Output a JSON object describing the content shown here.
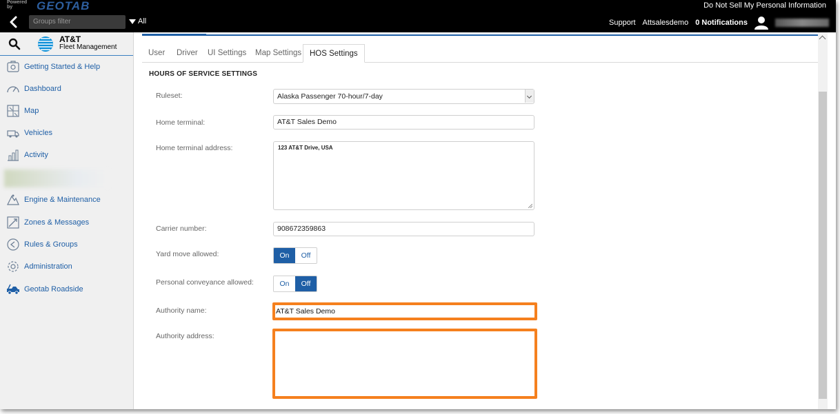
{
  "topbar": {
    "powered_by": "Powered by",
    "geotab": "GEOTAB",
    "do_not_sell": "Do Not Sell My Personal Information",
    "groups_filter_placeholder": "Groups filter",
    "all_label": "All",
    "support": "Support",
    "account": "Attsalesdemo",
    "notifications": "0 Notifications"
  },
  "sidebar": {
    "brand_line1": "AT&T",
    "brand_line2": "Fleet Management",
    "items": [
      {
        "label": "Getting Started & Help",
        "icon": "help-box-icon"
      },
      {
        "label": "Dashboard",
        "icon": "gauge-icon"
      },
      {
        "label": "Map",
        "icon": "map-icon"
      },
      {
        "label": "Vehicles",
        "icon": "truck-icon"
      },
      {
        "label": "Activity",
        "icon": "bar-chart-icon"
      },
      {
        "label": "Engine & Maintenance",
        "icon": "engine-icon"
      },
      {
        "label": "Zones & Messages",
        "icon": "zones-icon"
      },
      {
        "label": "Rules & Groups",
        "icon": "rules-icon"
      },
      {
        "label": "Administration",
        "icon": "gear-icon"
      },
      {
        "label": "Geotab Roadside",
        "icon": "tow-truck-icon"
      }
    ]
  },
  "tabs": [
    "User",
    "Driver",
    "UI Settings",
    "Map Settings",
    "HOS Settings"
  ],
  "active_tab": "HOS Settings",
  "section_title": "HOURS OF SERVICE SETTINGS",
  "form": {
    "ruleset_label": "Ruleset:",
    "ruleset_value": "Alaska Passenger 70-hour/7-day",
    "home_terminal_label": "Home terminal:",
    "home_terminal_value": "AT&T Sales Demo",
    "home_terminal_address_label": "Home terminal address:",
    "home_terminal_address_value": "123 AT&T Drive, USA",
    "carrier_number_label": "Carrier number:",
    "carrier_number_value": "908672359863",
    "yard_move_label": "Yard move allowed:",
    "yard_move_value": "On",
    "personal_conveyance_label": "Personal conveyance allowed:",
    "personal_conveyance_value": "Off",
    "toggle_on": "On",
    "toggle_off": "Off",
    "authority_name_label": "Authority name:",
    "authority_name_value": "AT&T Sales Demo",
    "authority_address_label": "Authority address:",
    "authority_address_value": ""
  },
  "colors": {
    "accent": "#1f5fa6",
    "highlight": "#f5801e",
    "topbar": "#000000"
  }
}
